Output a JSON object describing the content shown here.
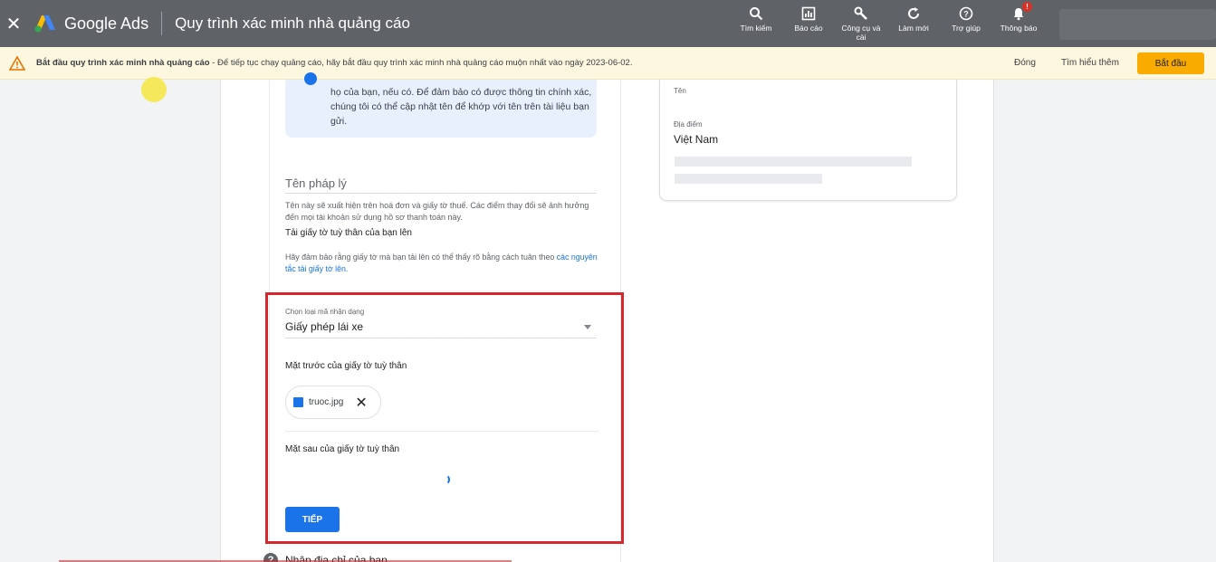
{
  "header": {
    "close_icon": "close-icon",
    "brand": "Google Ads",
    "title": "Quy trình xác minh nhà quảng cáo",
    "tools": [
      {
        "label": "Tìm kiếm",
        "icon": "search-icon"
      },
      {
        "label": "Báo cáo",
        "icon": "reports-icon"
      },
      {
        "label": "Công cụ và cài",
        "icon": "wrench-icon"
      },
      {
        "label": "Làm mới",
        "icon": "refresh-icon"
      },
      {
        "label": "Trợ giúp",
        "icon": "help-icon"
      },
      {
        "label": "Thông báo",
        "icon": "bell-icon",
        "badge": "!"
      }
    ]
  },
  "banner": {
    "bold": "Bắt đầu quy trình xác minh nhà quảng cáo",
    "text": " - Để tiếp tục chạy quảng cáo, hãy bắt đầu quy trình xác minh nhà quảng cáo muộn nhất vào ngày 2023-06-02.",
    "close_label": "Đóng",
    "learn_label": "Tìm hiểu thêm",
    "start_label": "Bắt đầu"
  },
  "main": {
    "info_text": "họ của bạn, nếu có. Để đảm bảo có được thông tin chính xác, chúng tôi có thể cập nhật tên để khớp với tên trên tài liệu bạn gửi.",
    "legal_title": "Tên pháp lý",
    "legal_desc": "Tên này sẽ xuất hiện trên hoá đơn và giấy tờ thuế. Các điểm thay đổi sẽ ảnh hưởng đến mọi tài khoản sử dụng hồ sơ thanh toán này.",
    "upload_title": "Tải giấy tờ tuỳ thân của bạn lên",
    "upload_desc": "Hãy đảm bảo rằng giấy tờ mà bạn tải lên có thể thấy rõ bằng cách tuân theo ",
    "upload_link": "các nguyên tắc tải giấy tờ lên.",
    "id_type_label": "Chọn loại mã nhận dạng",
    "id_type_value": "Giấy phép lái xe",
    "front_label": "Mặt trước của giấy tờ tuỳ thân",
    "front_file": "truoc.jpg",
    "back_label": "Mặt sau của giấy tờ tuỳ thân",
    "next_label": "TIẾP",
    "address_title": "Nhập địa chỉ của bạn"
  },
  "card": {
    "name_label": "Tên",
    "location_label": "Địa điểm",
    "location_value": "Việt Nam"
  },
  "colors": {
    "topbar": "#5f6368",
    "banner_bg": "#fef7e0",
    "accent": "#1a73e8",
    "start_button": "#f9ab00",
    "highlight_border": "#d7262d"
  }
}
